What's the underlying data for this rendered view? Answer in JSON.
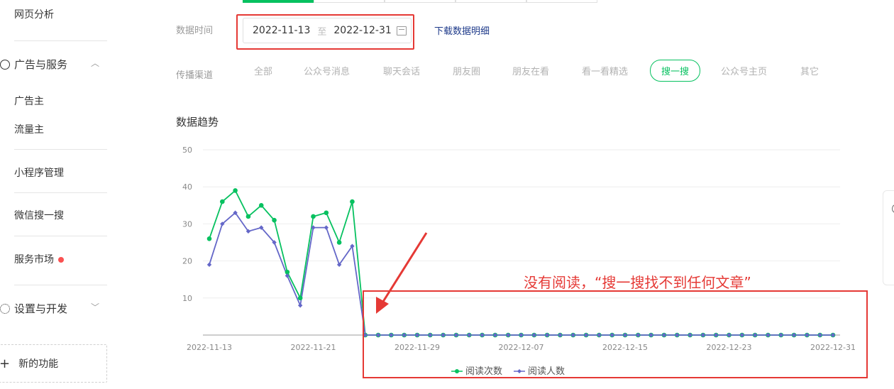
{
  "sidebar": {
    "web_analysis": "网页分析",
    "ads_group": "广告与服务",
    "advertiser": "广告主",
    "publisher": "流量主",
    "miniprogram": "小程序管理",
    "wechat_search": "微信搜一搜",
    "service_market": "服务市场",
    "settings_group": "设置与开发",
    "new_feature": "新的功能"
  },
  "filters": {
    "date_label": "数据时间",
    "date_start": "2022-11-13",
    "date_sep": "至",
    "date_end": "2022-12-31",
    "download": "下载数据明细",
    "channel_label": "传播渠道",
    "channels": [
      "全部",
      "公众号消息",
      "聊天会话",
      "朋友圈",
      "朋友在看",
      "看一看精选",
      "搜一搜",
      "公众号主页",
      "其它"
    ],
    "active_channel": "搜一搜"
  },
  "section_title": "数据趋势",
  "annotation": "没有阅读，“搜一搜找不到任何文章”",
  "colors": {
    "green": "#07c160",
    "blue": "#6467c8",
    "red": "#e53935"
  },
  "chart_data": {
    "type": "line",
    "title": "",
    "x": [
      "2022-11-13",
      "2022-11-14",
      "2022-11-15",
      "2022-11-16",
      "2022-11-17",
      "2022-11-18",
      "2022-11-19",
      "2022-11-20",
      "2022-11-21",
      "2022-11-22",
      "2022-11-23",
      "2022-11-24",
      "2022-11-25",
      "2022-11-26",
      "2022-11-27",
      "2022-11-28",
      "2022-11-29",
      "2022-11-30",
      "2022-12-01",
      "2022-12-02",
      "2022-12-03",
      "2022-12-04",
      "2022-12-05",
      "2022-12-06",
      "2022-12-07",
      "2022-12-08",
      "2022-12-09",
      "2022-12-10",
      "2022-12-11",
      "2022-12-12",
      "2022-12-13",
      "2022-12-14",
      "2022-12-15",
      "2022-12-16",
      "2022-12-17",
      "2022-12-18",
      "2022-12-19",
      "2022-12-20",
      "2022-12-21",
      "2022-12-22",
      "2022-12-23",
      "2022-12-24",
      "2022-12-25",
      "2022-12-26",
      "2022-12-27",
      "2022-12-28",
      "2022-12-29",
      "2022-12-30",
      "2022-12-31"
    ],
    "x_tick_labels": [
      "2022-11-13",
      "2022-11-21",
      "2022-11-29",
      "2022-12-07",
      "2022-12-15",
      "2022-12-23",
      "2022-12-31"
    ],
    "y_ticks": [
      10,
      20,
      30,
      40,
      50
    ],
    "ylim": [
      0,
      50
    ],
    "series": [
      {
        "name": "阅读次数",
        "color": "#07c160",
        "marker": "circle",
        "values": [
          26,
          36,
          39,
          32,
          35,
          31,
          17,
          10,
          32,
          33,
          25,
          36,
          0,
          0,
          0,
          0,
          0,
          0,
          0,
          0,
          0,
          0,
          0,
          0,
          0,
          0,
          0,
          0,
          0,
          0,
          0,
          0,
          0,
          0,
          0,
          0,
          0,
          0,
          0,
          0,
          0,
          0,
          0,
          0,
          0,
          0,
          0,
          0,
          0
        ]
      },
      {
        "name": "阅读人数",
        "color": "#6467c8",
        "marker": "diamond",
        "values": [
          19,
          30,
          33,
          28,
          29,
          25,
          16,
          8,
          29,
          29,
          19,
          24,
          0,
          0,
          0,
          0,
          0,
          0,
          0,
          0,
          0,
          0,
          0,
          0,
          0,
          0,
          0,
          0,
          0,
          0,
          0,
          0,
          0,
          0,
          0,
          0,
          0,
          0,
          0,
          0,
          0,
          0,
          0,
          0,
          0,
          0,
          0,
          0,
          0
        ]
      }
    ],
    "grid": true,
    "legend": "bottom-center"
  }
}
